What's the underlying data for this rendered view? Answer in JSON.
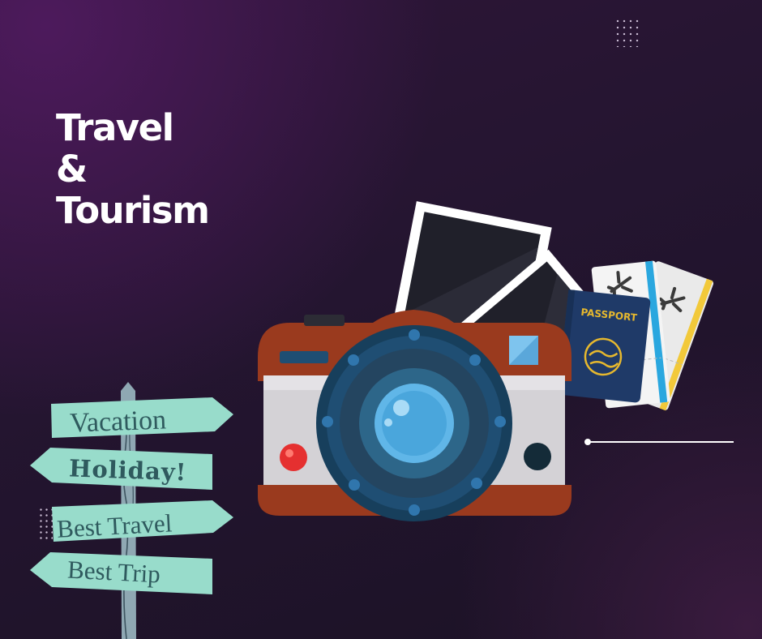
{
  "headline": [
    "Travel",
    "&",
    "Tourism"
  ],
  "signpost": {
    "vacation": "Vacation",
    "holiday": "Holiday!",
    "best_travel": "Best Travel",
    "best_trip": "Best Trip"
  },
  "passport_label": "PASSPORT",
  "colors": {
    "background": "#241530",
    "accent_purple": "#4d1a5c",
    "sign_mint": "#98dccb",
    "sign_text": "#2f5a5e",
    "camera_body": "#9a3a1e",
    "camera_lens": "#1f4e73",
    "passport_blue": "#1f3a68",
    "passport_gold": "#e6b82e"
  },
  "icons": [
    "camera-icon",
    "photo-frame-icon",
    "passport-icon",
    "plane-ticket-icon",
    "airplane-icon",
    "signpost-icon"
  ]
}
